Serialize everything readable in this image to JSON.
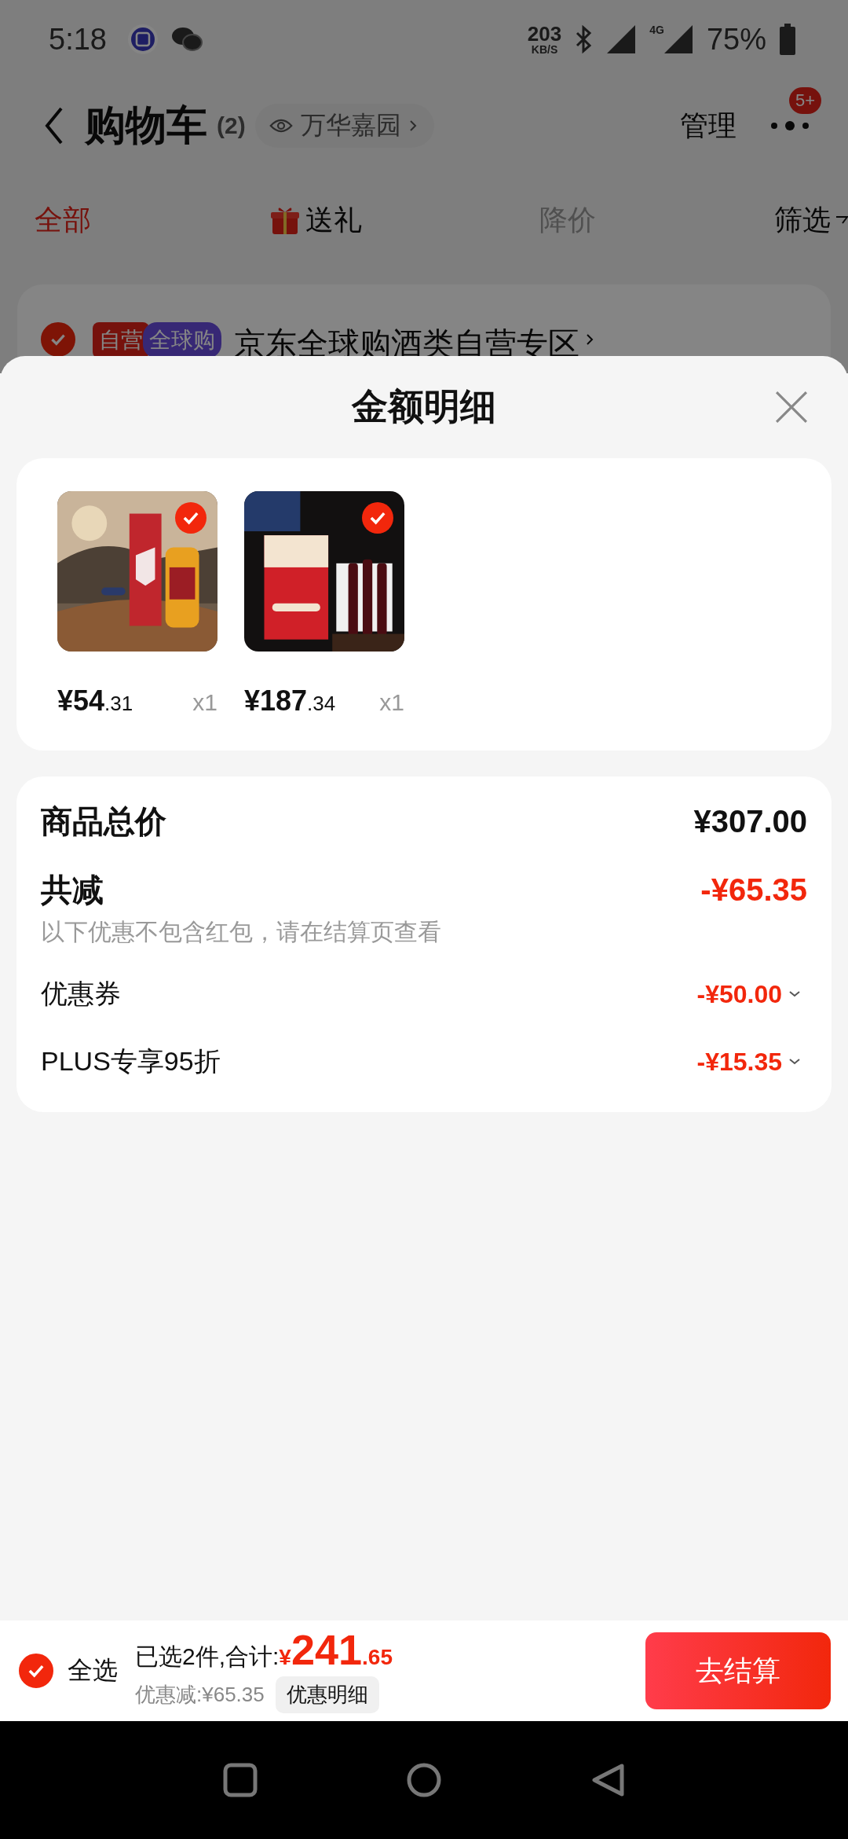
{
  "status_bar": {
    "time": "5:18",
    "net_speed": "203",
    "net_unit": "KB/S",
    "network": "4G",
    "battery": "75%"
  },
  "header": {
    "title": "购物车",
    "count": "(2)",
    "location": "万华嘉园",
    "manage": "管理",
    "badge": "5+"
  },
  "tabs": [
    {
      "label": "全部",
      "selected": true,
      "disabled": false,
      "kind": "text"
    },
    {
      "label": "送礼",
      "selected": false,
      "disabled": false,
      "kind": "gift"
    },
    {
      "label": "降价",
      "selected": false,
      "disabled": true,
      "kind": "text"
    },
    {
      "label": "筛选",
      "selected": false,
      "disabled": false,
      "kind": "filter"
    }
  ],
  "store": {
    "checked": true,
    "tags": [
      "自营",
      "全球购"
    ],
    "name": "京东全球购酒类自营专区"
  },
  "sheet": {
    "title": "金额明细"
  },
  "items": [
    {
      "kind": "picture",
      "checked": true,
      "price_int": "¥54",
      "price_dec": ".31",
      "qty": "x1"
    },
    {
      "kind": "picture",
      "checked": true,
      "price_int": "¥187",
      "price_dec": ".34",
      "qty": "x1"
    }
  ],
  "summary": {
    "total_label": "商品总价",
    "total": "¥307.00",
    "discount_label": "共减",
    "discount": "-¥65.35",
    "note": "以下优惠不包含红包，请在结算页查看",
    "lines": [
      {
        "label": "优惠券",
        "amount": "-¥50.00",
        "expanded": false
      },
      {
        "label": "PLUS专享95折",
        "amount": "-¥15.35",
        "expanded": false
      }
    ]
  },
  "bottom_bar": {
    "select_all_checked": true,
    "select_all": "全选",
    "selected_text": "已选2件,合计:",
    "currency": "¥",
    "total_int": "241",
    "total_dec": ".65",
    "discount_text": "优惠减:¥65.35",
    "detail_button": "优惠明细",
    "checkout": "去结算"
  }
}
